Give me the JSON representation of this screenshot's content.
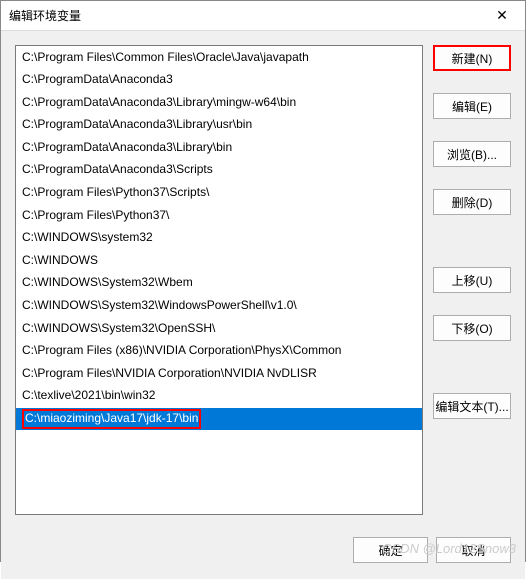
{
  "window": {
    "title": "编辑环境变量",
    "close_symbol": "✕"
  },
  "list": {
    "items": [
      "C:\\Program Files\\Common Files\\Oracle\\Java\\javapath",
      "C:\\ProgramData\\Anaconda3",
      "C:\\ProgramData\\Anaconda3\\Library\\mingw-w64\\bin",
      "C:\\ProgramData\\Anaconda3\\Library\\usr\\bin",
      "C:\\ProgramData\\Anaconda3\\Library\\bin",
      "C:\\ProgramData\\Anaconda3\\Scripts",
      "C:\\Program Files\\Python37\\Scripts\\",
      "C:\\Program Files\\Python37\\",
      "C:\\WINDOWS\\system32",
      "C:\\WINDOWS",
      "C:\\WINDOWS\\System32\\Wbem",
      "C:\\WINDOWS\\System32\\WindowsPowerShell\\v1.0\\",
      "C:\\WINDOWS\\System32\\OpenSSH\\",
      "C:\\Program Files (x86)\\NVIDIA Corporation\\PhysX\\Common",
      "C:\\Program Files\\NVIDIA Corporation\\NVIDIA NvDLISR",
      "C:\\texlive\\2021\\bin\\win32",
      "C:\\miaoziming\\Java17\\jdk-17\\bin"
    ],
    "selected_index": 16
  },
  "buttons": {
    "new": "新建(N)",
    "edit": "编辑(E)",
    "browse": "浏览(B)...",
    "delete": "删除(D)",
    "move_up": "上移(U)",
    "move_down": "下移(O)",
    "edit_text": "编辑文本(T)...",
    "ok": "确定",
    "cancel": "取消"
  },
  "watermark": "CSDN @Lord12Snow3"
}
